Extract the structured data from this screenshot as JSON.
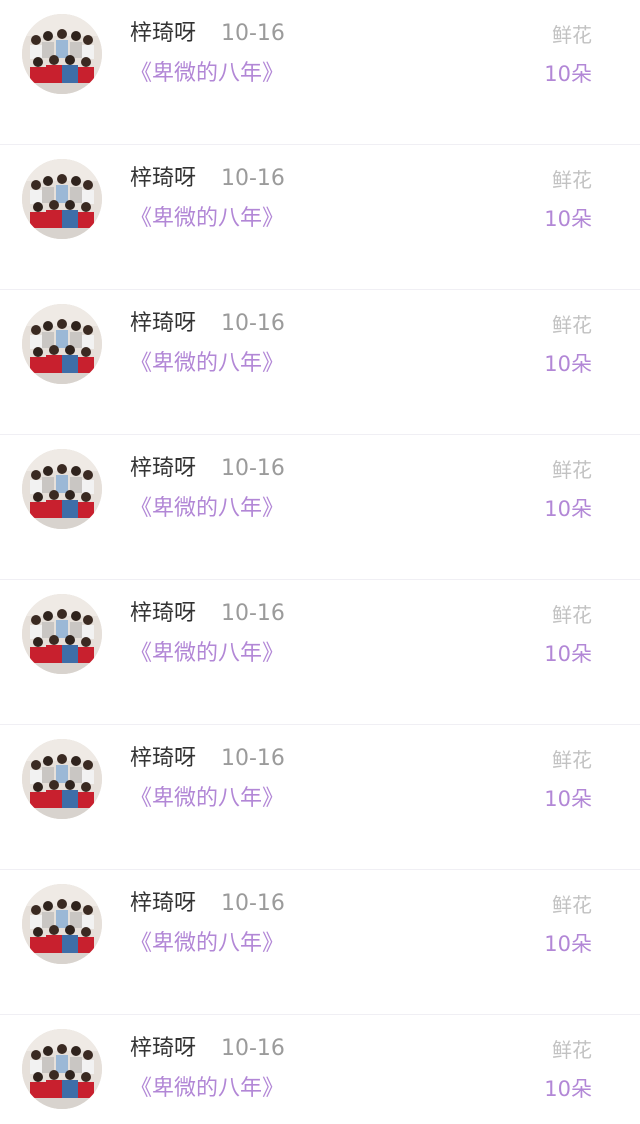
{
  "records": [
    {
      "name": "梓琦呀",
      "date": "10-16",
      "book": "《卑微的八年》",
      "gift_label": "鲜花",
      "gift_count": "10朵"
    },
    {
      "name": "梓琦呀",
      "date": "10-16",
      "book": "《卑微的八年》",
      "gift_label": "鲜花",
      "gift_count": "10朵"
    },
    {
      "name": "梓琦呀",
      "date": "10-16",
      "book": "《卑微的八年》",
      "gift_label": "鲜花",
      "gift_count": "10朵"
    },
    {
      "name": "梓琦呀",
      "date": "10-16",
      "book": "《卑微的八年》",
      "gift_label": "鲜花",
      "gift_count": "10朵"
    },
    {
      "name": "梓琦呀",
      "date": "10-16",
      "book": "《卑微的八年》",
      "gift_label": "鲜花",
      "gift_count": "10朵"
    },
    {
      "name": "梓琦呀",
      "date": "10-16",
      "book": "《卑微的八年》",
      "gift_label": "鲜花",
      "gift_count": "10朵"
    },
    {
      "name": "梓琦呀",
      "date": "10-16",
      "book": "《卑微的八年》",
      "gift_label": "鲜花",
      "gift_count": "10朵"
    },
    {
      "name": "梓琦呀",
      "date": "10-16",
      "book": "《卑微的八年》",
      "gift_label": "鲜花",
      "gift_count": "10朵"
    }
  ],
  "colors": {
    "name": "#333333",
    "date": "#9b9b9b",
    "accent": "#b287d6",
    "gift_label": "#c2c2c2",
    "divider": "#f0eff4"
  }
}
